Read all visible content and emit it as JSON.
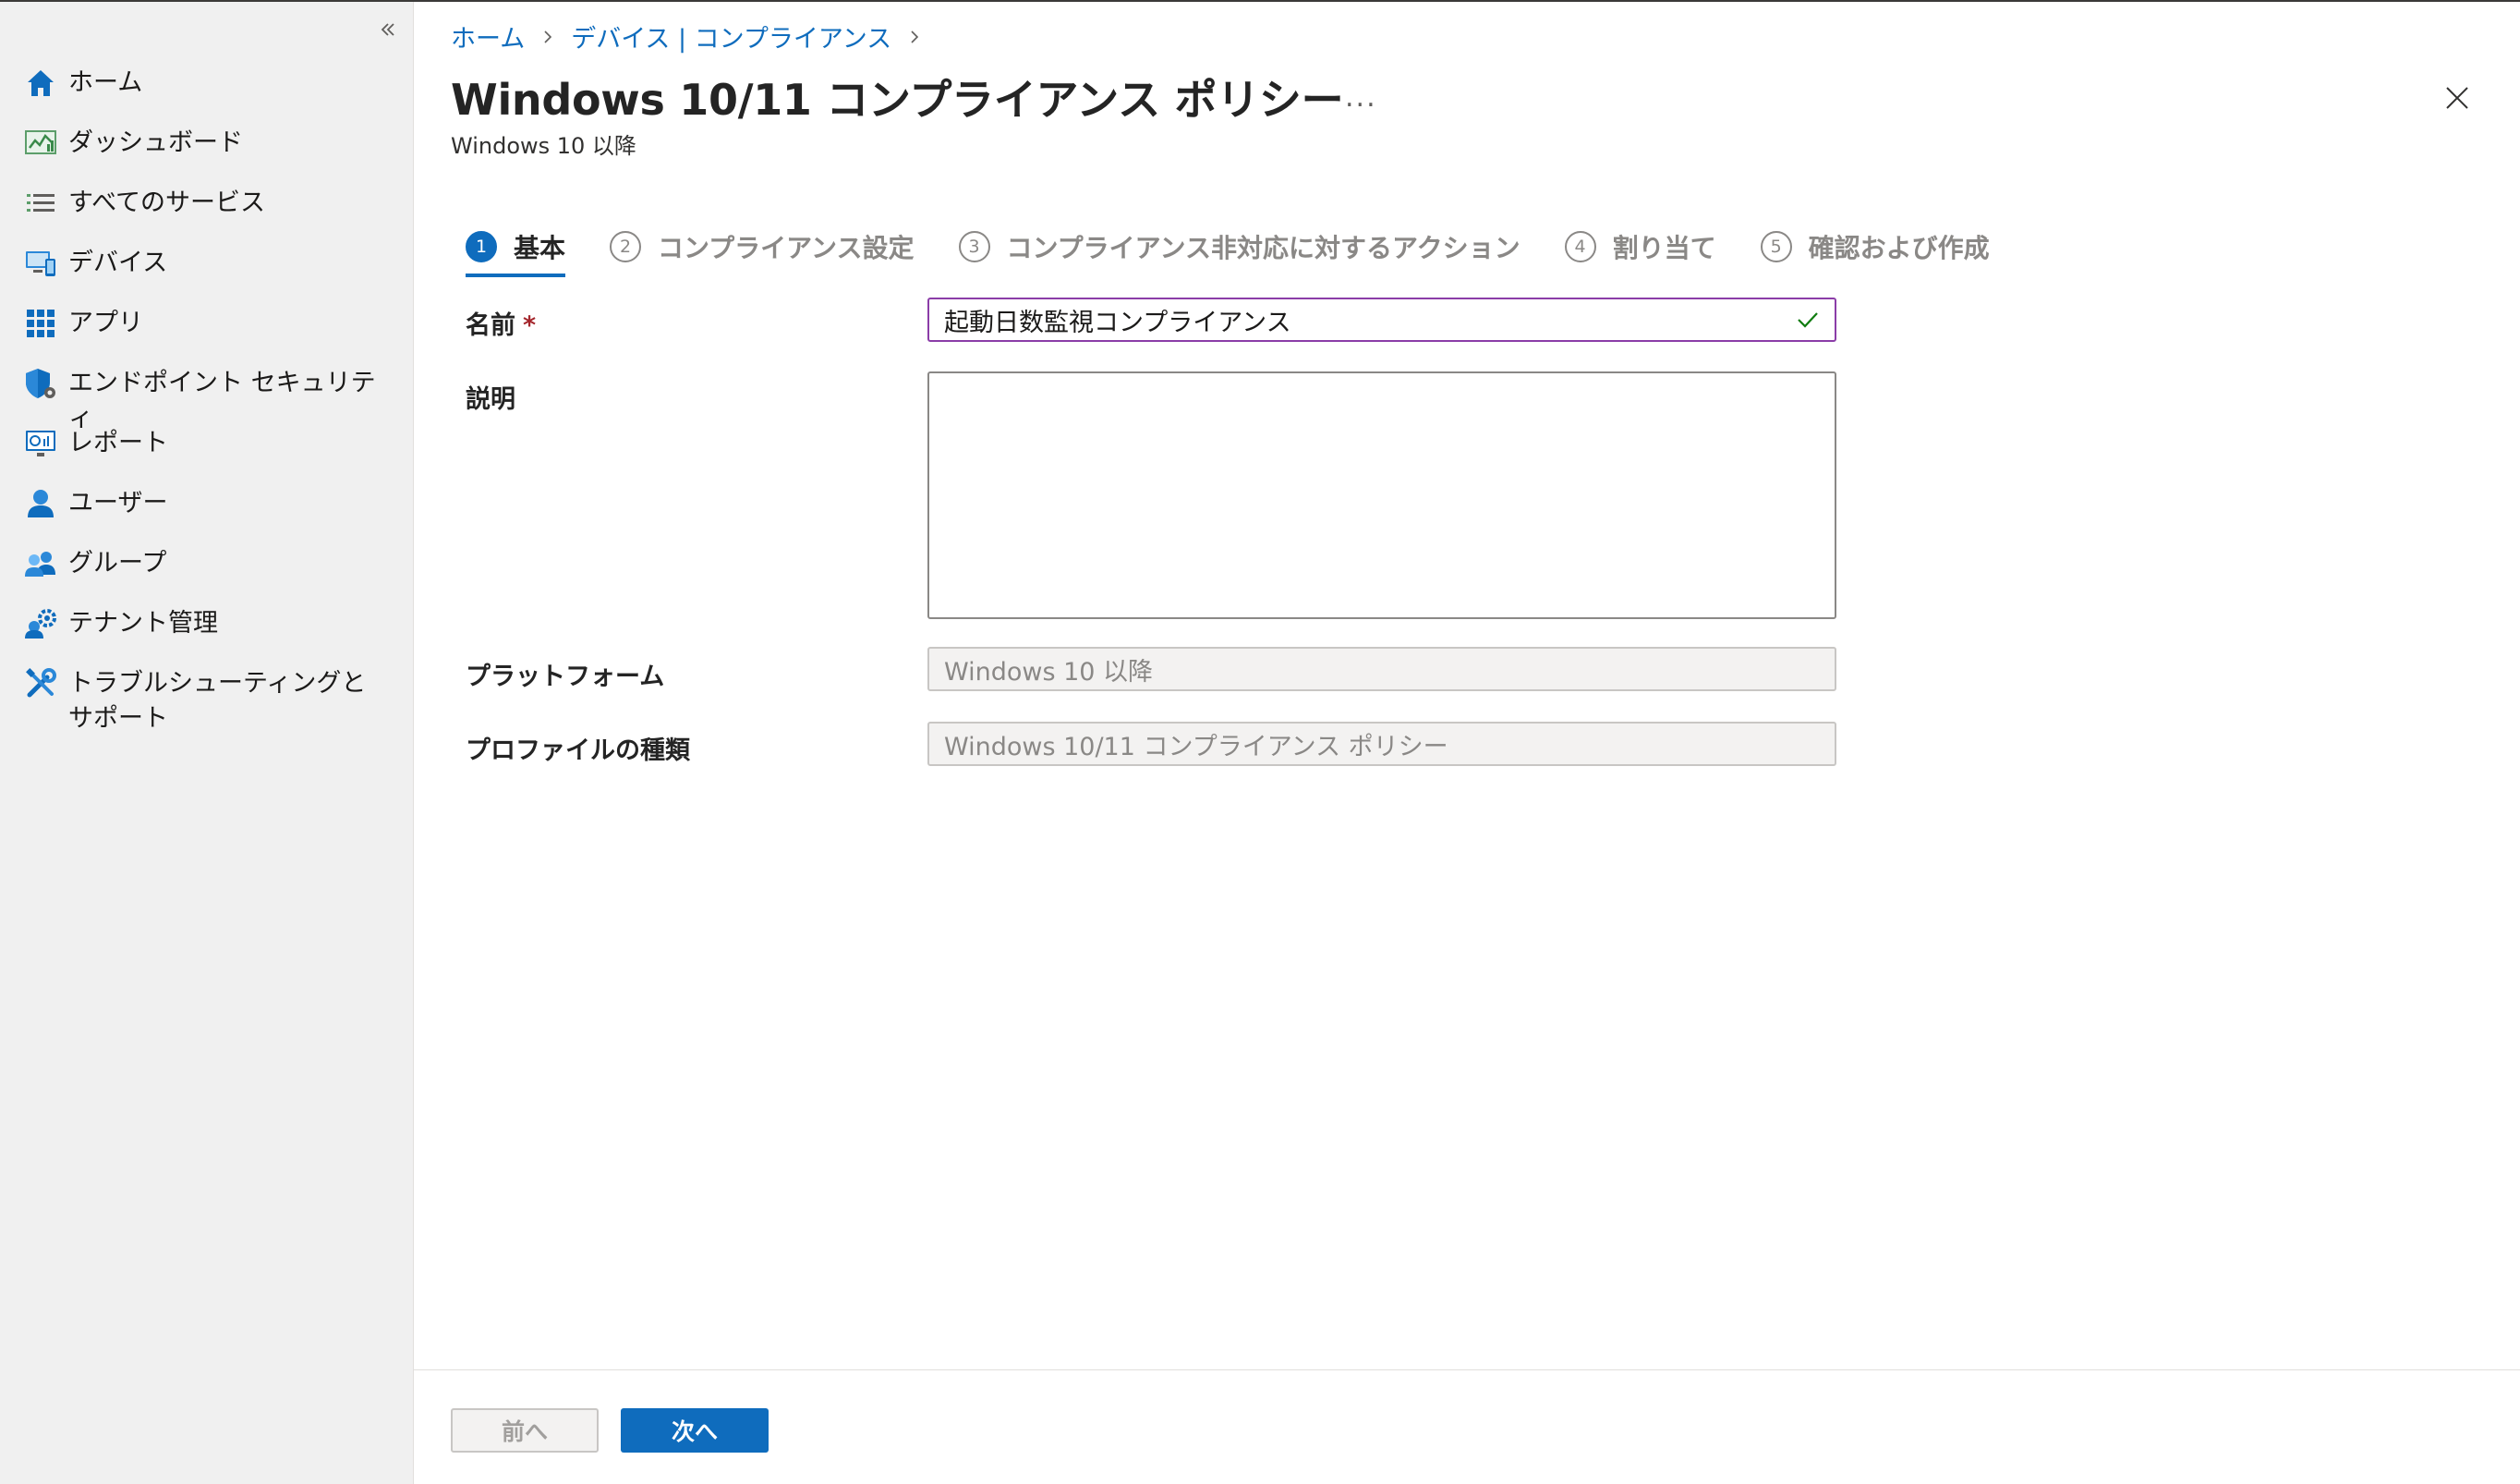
{
  "sidebar": {
    "items": [
      {
        "label": "ホーム",
        "icon": "home-icon"
      },
      {
        "label": "ダッシュボード",
        "icon": "dashboard-icon"
      },
      {
        "label": "すべてのサービス",
        "icon": "list-icon"
      },
      {
        "label": "デバイス",
        "icon": "devices-icon"
      },
      {
        "label": "アプリ",
        "icon": "apps-grid-icon"
      },
      {
        "label": "エンドポイント セキュリティ",
        "icon": "endpoint-security-shield-icon"
      },
      {
        "label": "レポート",
        "icon": "reports-monitor-icon"
      },
      {
        "label": "ユーザー",
        "icon": "user-icon"
      },
      {
        "label": "グループ",
        "icon": "group-icon"
      },
      {
        "label": "テナント管理",
        "icon": "tenant-admin-gear-icon"
      },
      {
        "label": "トラブルシューティングとサポート",
        "icon": "troubleshoot-tools-icon"
      }
    ]
  },
  "breadcrumb": {
    "items": [
      "ホーム",
      "デバイス | コンプライアンス"
    ]
  },
  "header": {
    "title": "Windows 10/11 コンプライアンス ポリシー",
    "more": "...",
    "subtitle": "Windows 10 以降"
  },
  "steps": [
    {
      "num": "1",
      "label": "基本",
      "active": true
    },
    {
      "num": "2",
      "label": "コンプライアンス設定",
      "active": false
    },
    {
      "num": "3",
      "label": "コンプライアンス非対応に対するアクション",
      "active": false
    },
    {
      "num": "4",
      "label": "割り当て",
      "active": false
    },
    {
      "num": "5",
      "label": "確認および作成",
      "active": false
    }
  ],
  "form": {
    "name_label": "名前",
    "required_mark": "*",
    "name_value": "起動日数監視コンプライアンス",
    "description_label": "説明",
    "description_value": "",
    "platform_label": "プラットフォーム",
    "platform_value": "Windows 10 以降",
    "profile_type_label": "プロファイルの種類",
    "profile_type_value": "Windows 10/11 コンプライアンス ポリシー"
  },
  "footer": {
    "prev_label": "前へ",
    "next_label": "次へ"
  },
  "colors": {
    "accent": "#0f6cbd",
    "name_field_border": "#8b3da8",
    "valid_check": "#107c10",
    "required": "#a4262c"
  }
}
